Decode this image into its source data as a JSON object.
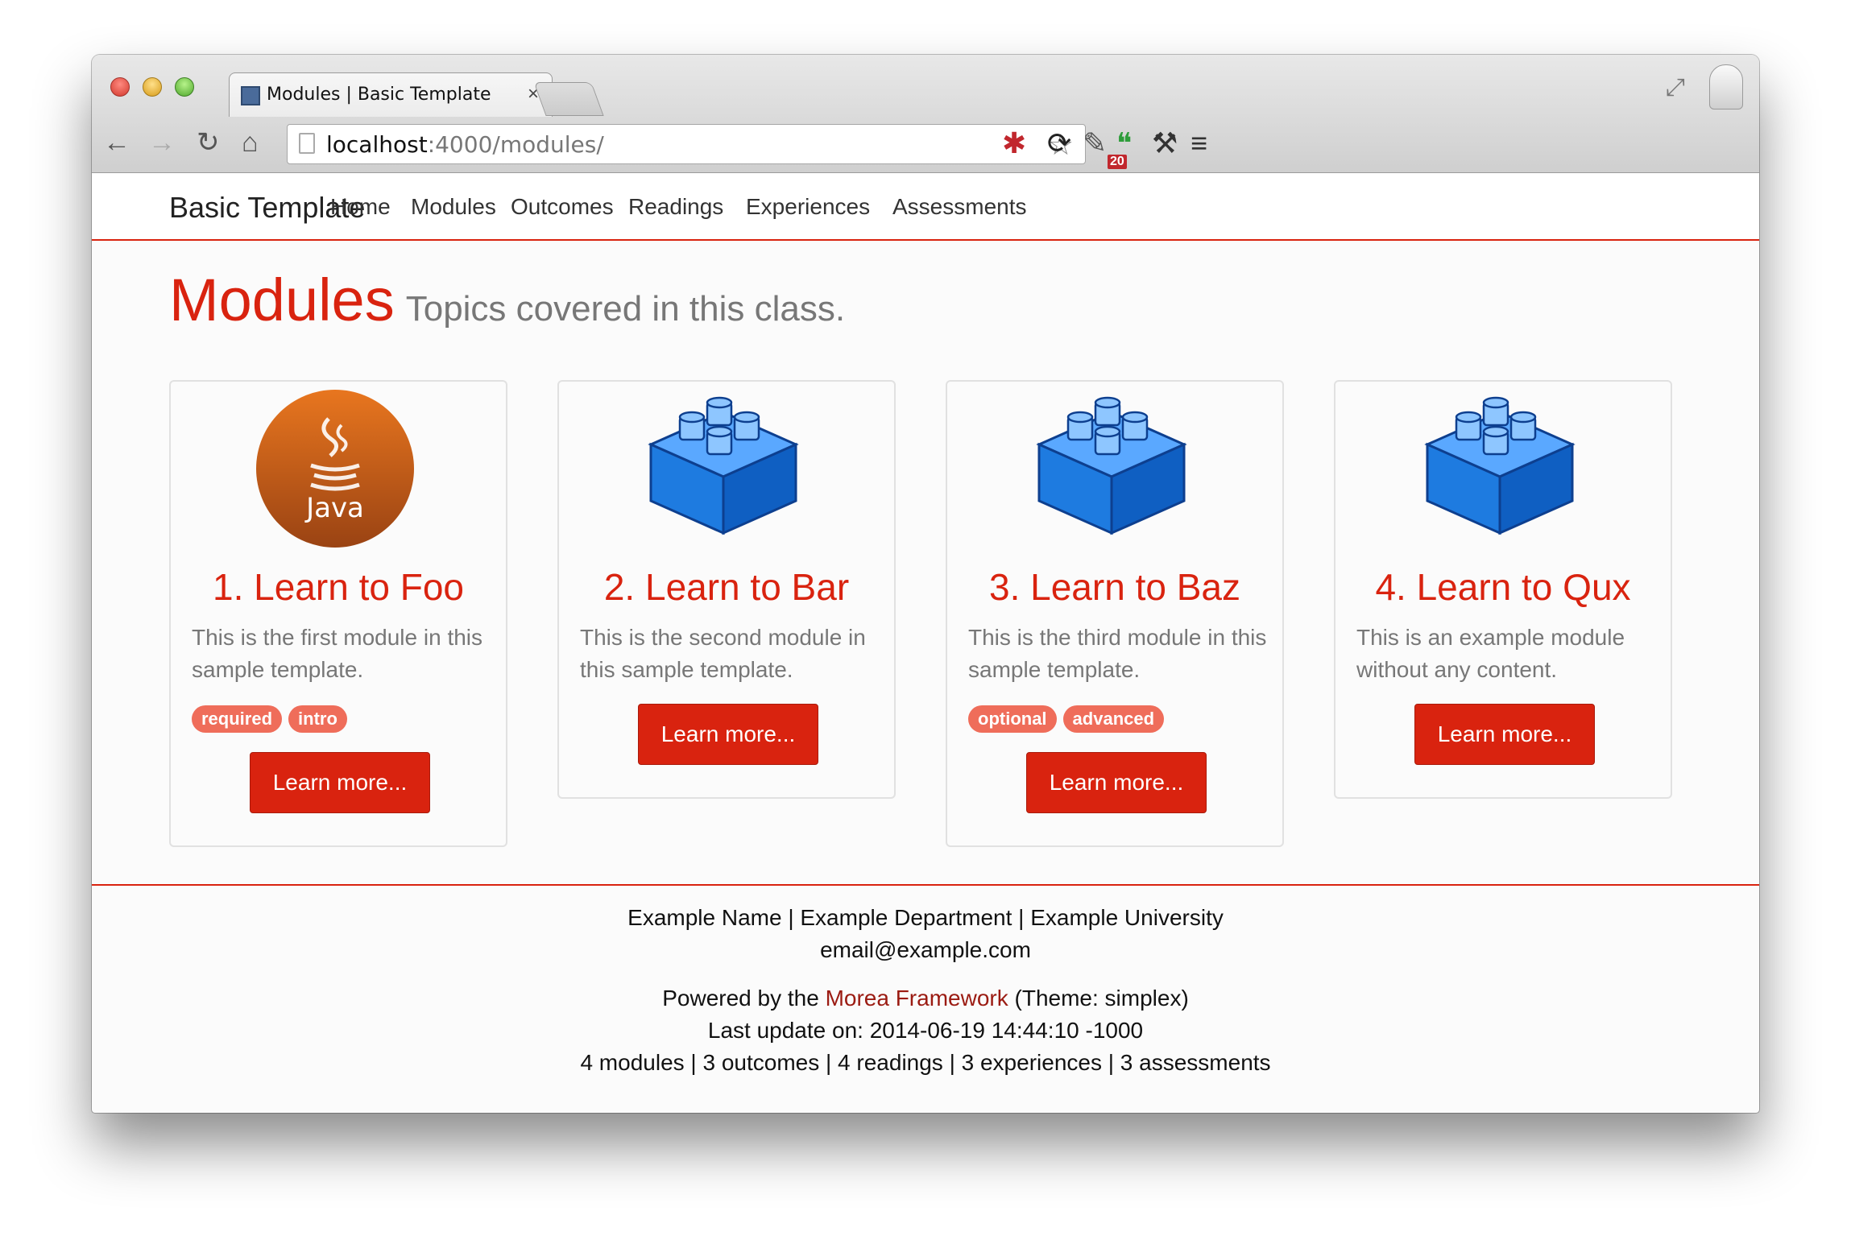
{
  "browser": {
    "tab_title": "Modules | Basic Template",
    "tab_close": "×",
    "url_host": "localhost",
    "url_path": ":4000/modules/",
    "extension_badge": "20"
  },
  "navbar": {
    "brand": "Basic Template",
    "links": [
      "Home",
      "Modules",
      "Outcomes",
      "Readings",
      "Experiences",
      "Assessments"
    ]
  },
  "page": {
    "title": "Modules",
    "subtitle": "Topics covered in this class."
  },
  "modules": [
    {
      "title": "1. Learn to Foo",
      "description": "This is the first module in this sample template.",
      "tags": [
        "required",
        "intro"
      ],
      "button": "Learn more...",
      "icon": "java-logo-icon",
      "icon_label": "Java"
    },
    {
      "title": "2. Learn to Bar",
      "description": "This is the second module in this sample template.",
      "tags": [],
      "button": "Learn more...",
      "icon": "lego-block-icon"
    },
    {
      "title": "3. Learn to Baz",
      "description": "This is the third module in this sample template.",
      "tags": [
        "optional",
        "advanced"
      ],
      "button": "Learn more...",
      "icon": "lego-block-icon"
    },
    {
      "title": "4. Learn to Qux",
      "description": "This is an example module without any content.",
      "tags": [],
      "button": "Learn more...",
      "icon": "lego-block-icon"
    }
  ],
  "footer": {
    "contact": "Example Name | Example Department | Example University",
    "email": "email@example.com",
    "powered_prefix": "Powered by the ",
    "powered_link": "Morea Framework",
    "powered_suffix": " (Theme: simplex)",
    "last_update": "Last update on: 2014-06-19 14:44:10 -1000",
    "counts": "4 modules | 3 outcomes | 4 readings | 3 experiences | 3 assessments"
  },
  "colors": {
    "accent": "#d9230f",
    "tag": "#ef6d5a",
    "lego_blue": "#1e7be0",
    "java_orange": "#c8601a"
  }
}
